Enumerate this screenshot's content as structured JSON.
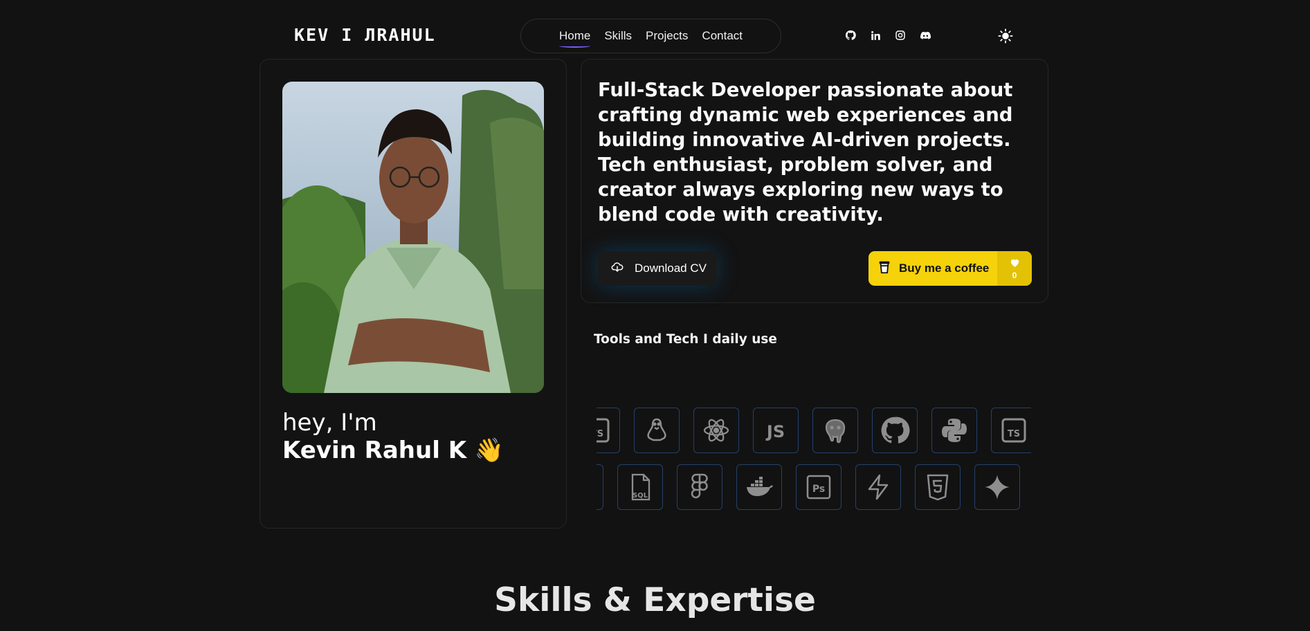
{
  "header": {
    "logo": "KEV I ЛRAHUL",
    "nav": [
      {
        "label": "Home",
        "active": true
      },
      {
        "label": "Skills",
        "active": false
      },
      {
        "label": "Projects",
        "active": false
      },
      {
        "label": "Contact",
        "active": false
      }
    ],
    "socials": [
      "github-icon",
      "linkedin-icon",
      "instagram-icon",
      "discord-icon"
    ],
    "theme_icon": "sun-icon"
  },
  "profile": {
    "greeting": "hey, I'm",
    "name": "Kevin Rahul K 👋"
  },
  "intro": {
    "text": "Full-Stack Developer passionate about crafting dynamic web experiences and building innovative AI-driven projects. Tech enthusiast, problem solver, and creator always exploring new ways to blend code with creativity.",
    "download_label": "Download CV",
    "coffee_label": "Buy me a coffee",
    "coffee_count": "0"
  },
  "tools": {
    "title": "Tools and Tech I daily use",
    "row1": [
      "typescript-icon",
      "linux-icon",
      "react-icon",
      "javascript-icon",
      "postgresql-icon",
      "github-icon",
      "python-icon",
      "typescript-icon"
    ],
    "row2": [
      "partial-icon",
      "sql-icon",
      "figma-icon",
      "docker-icon",
      "photoshop-icon",
      "supabase-icon",
      "html5-icon",
      "gemini-icon"
    ]
  },
  "sections": {
    "skills_title": "Skills & Expertise"
  },
  "colors": {
    "background": "#121212",
    "accent": "#7c5cff",
    "coffee_yellow": "#f5d20a",
    "tool_border": "#26406a"
  }
}
